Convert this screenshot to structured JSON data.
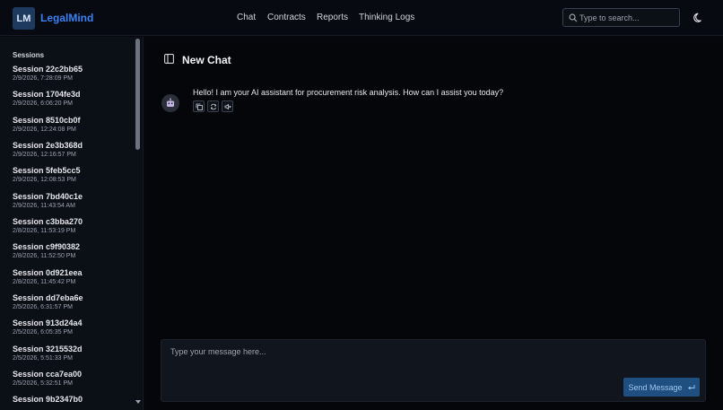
{
  "app": {
    "logo_badge": "LM",
    "name": "LegalMind",
    "accent_color": "#3b82f6"
  },
  "nav": {
    "items": [
      {
        "label": "Chat"
      },
      {
        "label": "Contracts"
      },
      {
        "label": "Reports"
      },
      {
        "label": "Thinking Logs"
      }
    ]
  },
  "search": {
    "placeholder": "Type to search...",
    "icon": "search-icon"
  },
  "theme_toggle": {
    "icon": "moon-icon"
  },
  "sidebar": {
    "title": "Sessions",
    "sessions": [
      {
        "name": "Session 22c2bb65",
        "time": "2/9/2026, 7:28:09 PM"
      },
      {
        "name": "Session 1704fe3d",
        "time": "2/9/2026, 6:06:20 PM"
      },
      {
        "name": "Session 8510cb0f",
        "time": "2/9/2026, 12:24:08 PM"
      },
      {
        "name": "Session 2e3b368d",
        "time": "2/9/2026, 12:16:57 PM"
      },
      {
        "name": "Session 5feb5cc5",
        "time": "2/9/2026, 12:08:53 PM"
      },
      {
        "name": "Session 7bd40c1e",
        "time": "2/9/2026, 11:43:54 AM"
      },
      {
        "name": "Session c3bba270",
        "time": "2/8/2026, 11:53:19 PM"
      },
      {
        "name": "Session c9f90382",
        "time": "2/8/2026, 11:52:50 PM"
      },
      {
        "name": "Session 0d921eea",
        "time": "2/8/2026, 11:45:42 PM"
      },
      {
        "name": "Session dd7eba6e",
        "time": "2/5/2026, 6:31:57 PM"
      },
      {
        "name": "Session 913d24a4",
        "time": "2/5/2026, 6:05:35 PM"
      },
      {
        "name": "Session 3215532d",
        "time": "2/5/2026, 5:51:33 PM"
      },
      {
        "name": "Session cca7ea00",
        "time": "2/5/2026, 5:32:51 PM"
      },
      {
        "name": "Session 9b2347b0",
        "time": ""
      }
    ]
  },
  "chat": {
    "title": "New Chat",
    "messages": [
      {
        "role": "assistant",
        "text": "Hello! I am your AI assistant for procurement risk analysis. How can I assist you today?"
      }
    ],
    "actions": [
      "copy-icon",
      "regenerate-icon",
      "speaker-icon"
    ]
  },
  "composer": {
    "placeholder": "Type your message here...",
    "value": "",
    "send_label": "Send Message"
  }
}
